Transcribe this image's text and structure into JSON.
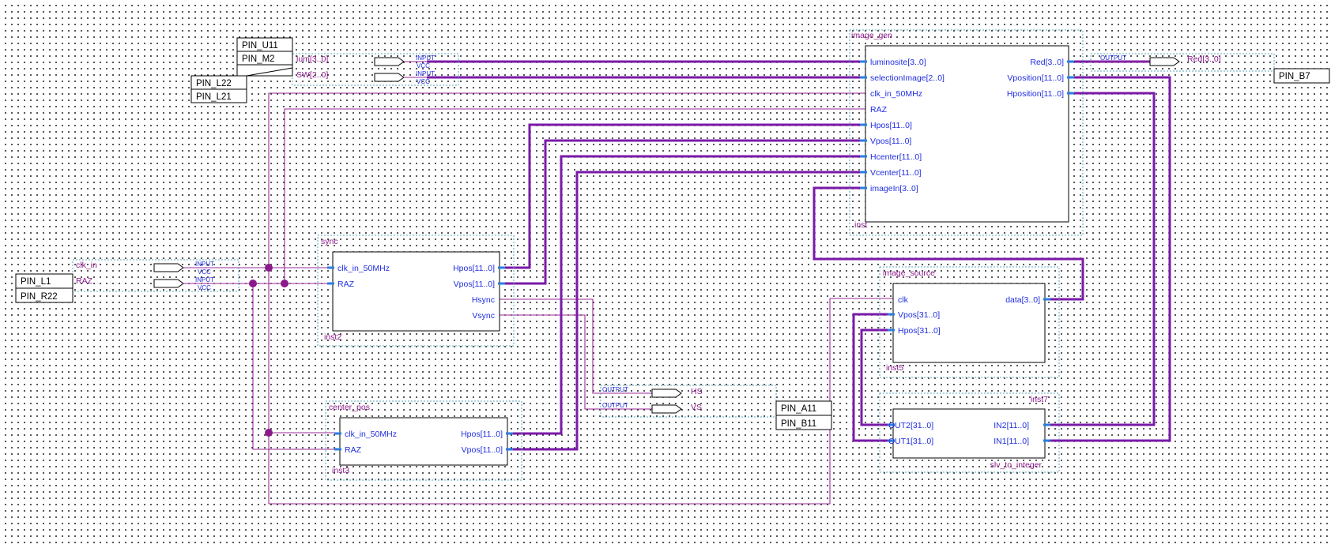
{
  "colors": {
    "wire": "#9a2a9a",
    "bus": "#7a1aa8",
    "port_stub": "#2a7de0",
    "port_text": "#1f2de0",
    "name_text": "#8a1a8a",
    "group_border": "#5aa6b8"
  },
  "blocks": {
    "image_gen": {
      "name": "image_gen",
      "instance": "inst",
      "inputs": [
        "luminosite[3..0]",
        "selectionImage[2..0]",
        "clk_in_50MHz",
        "RAZ",
        "Hpos[11..0]",
        "Vpos[11..0]",
        "Hcenter[11..0]",
        "Vcenter[11..0]",
        "imageIn[3..0]"
      ],
      "outputs": [
        "Red[3..0]",
        "Vposition[11..0]",
        "Hposition[11..0]"
      ]
    },
    "sync": {
      "name": "sync",
      "instance": "inst2",
      "inputs": [
        "clk_in_50MHz",
        "RAZ"
      ],
      "outputs": [
        "Hpos[11..0]",
        "Vpos[11..0]",
        "Hsync",
        "Vsync"
      ]
    },
    "center_pos": {
      "name": "center_pos",
      "instance": "inst3",
      "inputs": [
        "clk_in_50MHz",
        "RAZ"
      ],
      "outputs": [
        "Hpos[11..0]",
        "Vpos[11..0]"
      ]
    },
    "image_source": {
      "name": "image_source",
      "instance": "inst5",
      "inputs": [
        "clk",
        "Vpos[31..0]",
        "Hpos[31..0]"
      ],
      "outputs": [
        "data[3..0]"
      ]
    },
    "slv_to_integer": {
      "name": "slv_to_integer",
      "instance": "inst7",
      "left_ports": [
        "OUT2[31..0]",
        "OUT1[31..0]"
      ],
      "right_ports": [
        "IN2[11..0]",
        "IN1[11..0]"
      ]
    }
  },
  "io": {
    "inputs": [
      {
        "signal": "lum[3..0]",
        "type": "INPUT",
        "default": "VCC"
      },
      {
        "signal": "SW[2..0]",
        "type": "INPUT",
        "default": "VCC"
      },
      {
        "signal": "clk_in",
        "type": "INPUT",
        "default": "VCC"
      },
      {
        "signal": "RAZ",
        "type": "INPUT",
        "default": "VCC"
      }
    ],
    "outputs": [
      {
        "signal": "Red[3..0]",
        "type": "OUTPUT"
      },
      {
        "signal": "HS",
        "type": "OUTPUT"
      },
      {
        "signal": "VS",
        "type": "OUTPUT"
      }
    ]
  },
  "pins": {
    "top_group": [
      "PIN_U11",
      "PIN_M2",
      "PIN_L22",
      "PIN_L21"
    ],
    "left_group": [
      "PIN_L1",
      "PIN_R22"
    ],
    "mid_group": [
      "PIN_A11",
      "PIN_B11"
    ],
    "right_single": [
      "PIN_B7"
    ]
  }
}
